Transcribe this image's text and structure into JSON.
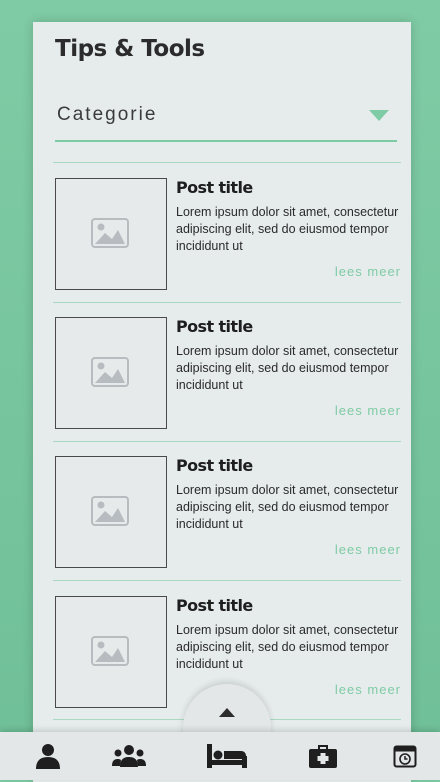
{
  "page": {
    "title": "Tips & Tools"
  },
  "filter": {
    "label": "Categorie",
    "caret_icon": "chevron-down-icon",
    "accent": "#7fcba5"
  },
  "posts": [
    {
      "title": "Post title",
      "excerpt": "Lorem ipsum dolor sit amet, consectetur adipiscing elit, sed do eiusmod tempor incididunt ut",
      "more": "lees meer",
      "image_icon": "image-placeholder-icon"
    },
    {
      "title": "Post title",
      "excerpt": "Lorem ipsum dolor sit amet, consectetur adipiscing elit, sed do eiusmod tempor incididunt ut",
      "more": "lees meer",
      "image_icon": "image-placeholder-icon"
    },
    {
      "title": "Post title",
      "excerpt": "Lorem ipsum dolor sit amet, consectetur adipiscing elit, sed do eiusmod tempor incididunt ut",
      "more": "lees meer",
      "image_icon": "image-placeholder-icon"
    },
    {
      "title": "Post title",
      "excerpt": "Lorem ipsum dolor sit amet, consectetur adipiscing elit, sed do eiusmod tempor incididunt ut",
      "more": "lees meer",
      "image_icon": "image-placeholder-icon"
    }
  ],
  "navbar": {
    "items": [
      {
        "icon": "user-icon"
      },
      {
        "icon": "group-icon"
      },
      {
        "icon": "bed-icon"
      },
      {
        "icon": "first-aid-kit-icon"
      },
      {
        "icon": "clock-icon"
      }
    ],
    "scroll_up_icon": "arrow-up-icon"
  },
  "colors": {
    "background": "#7fcba5",
    "panel": "#e6ecec",
    "accent": "#7fcba5",
    "text": "#2b2b2b"
  }
}
